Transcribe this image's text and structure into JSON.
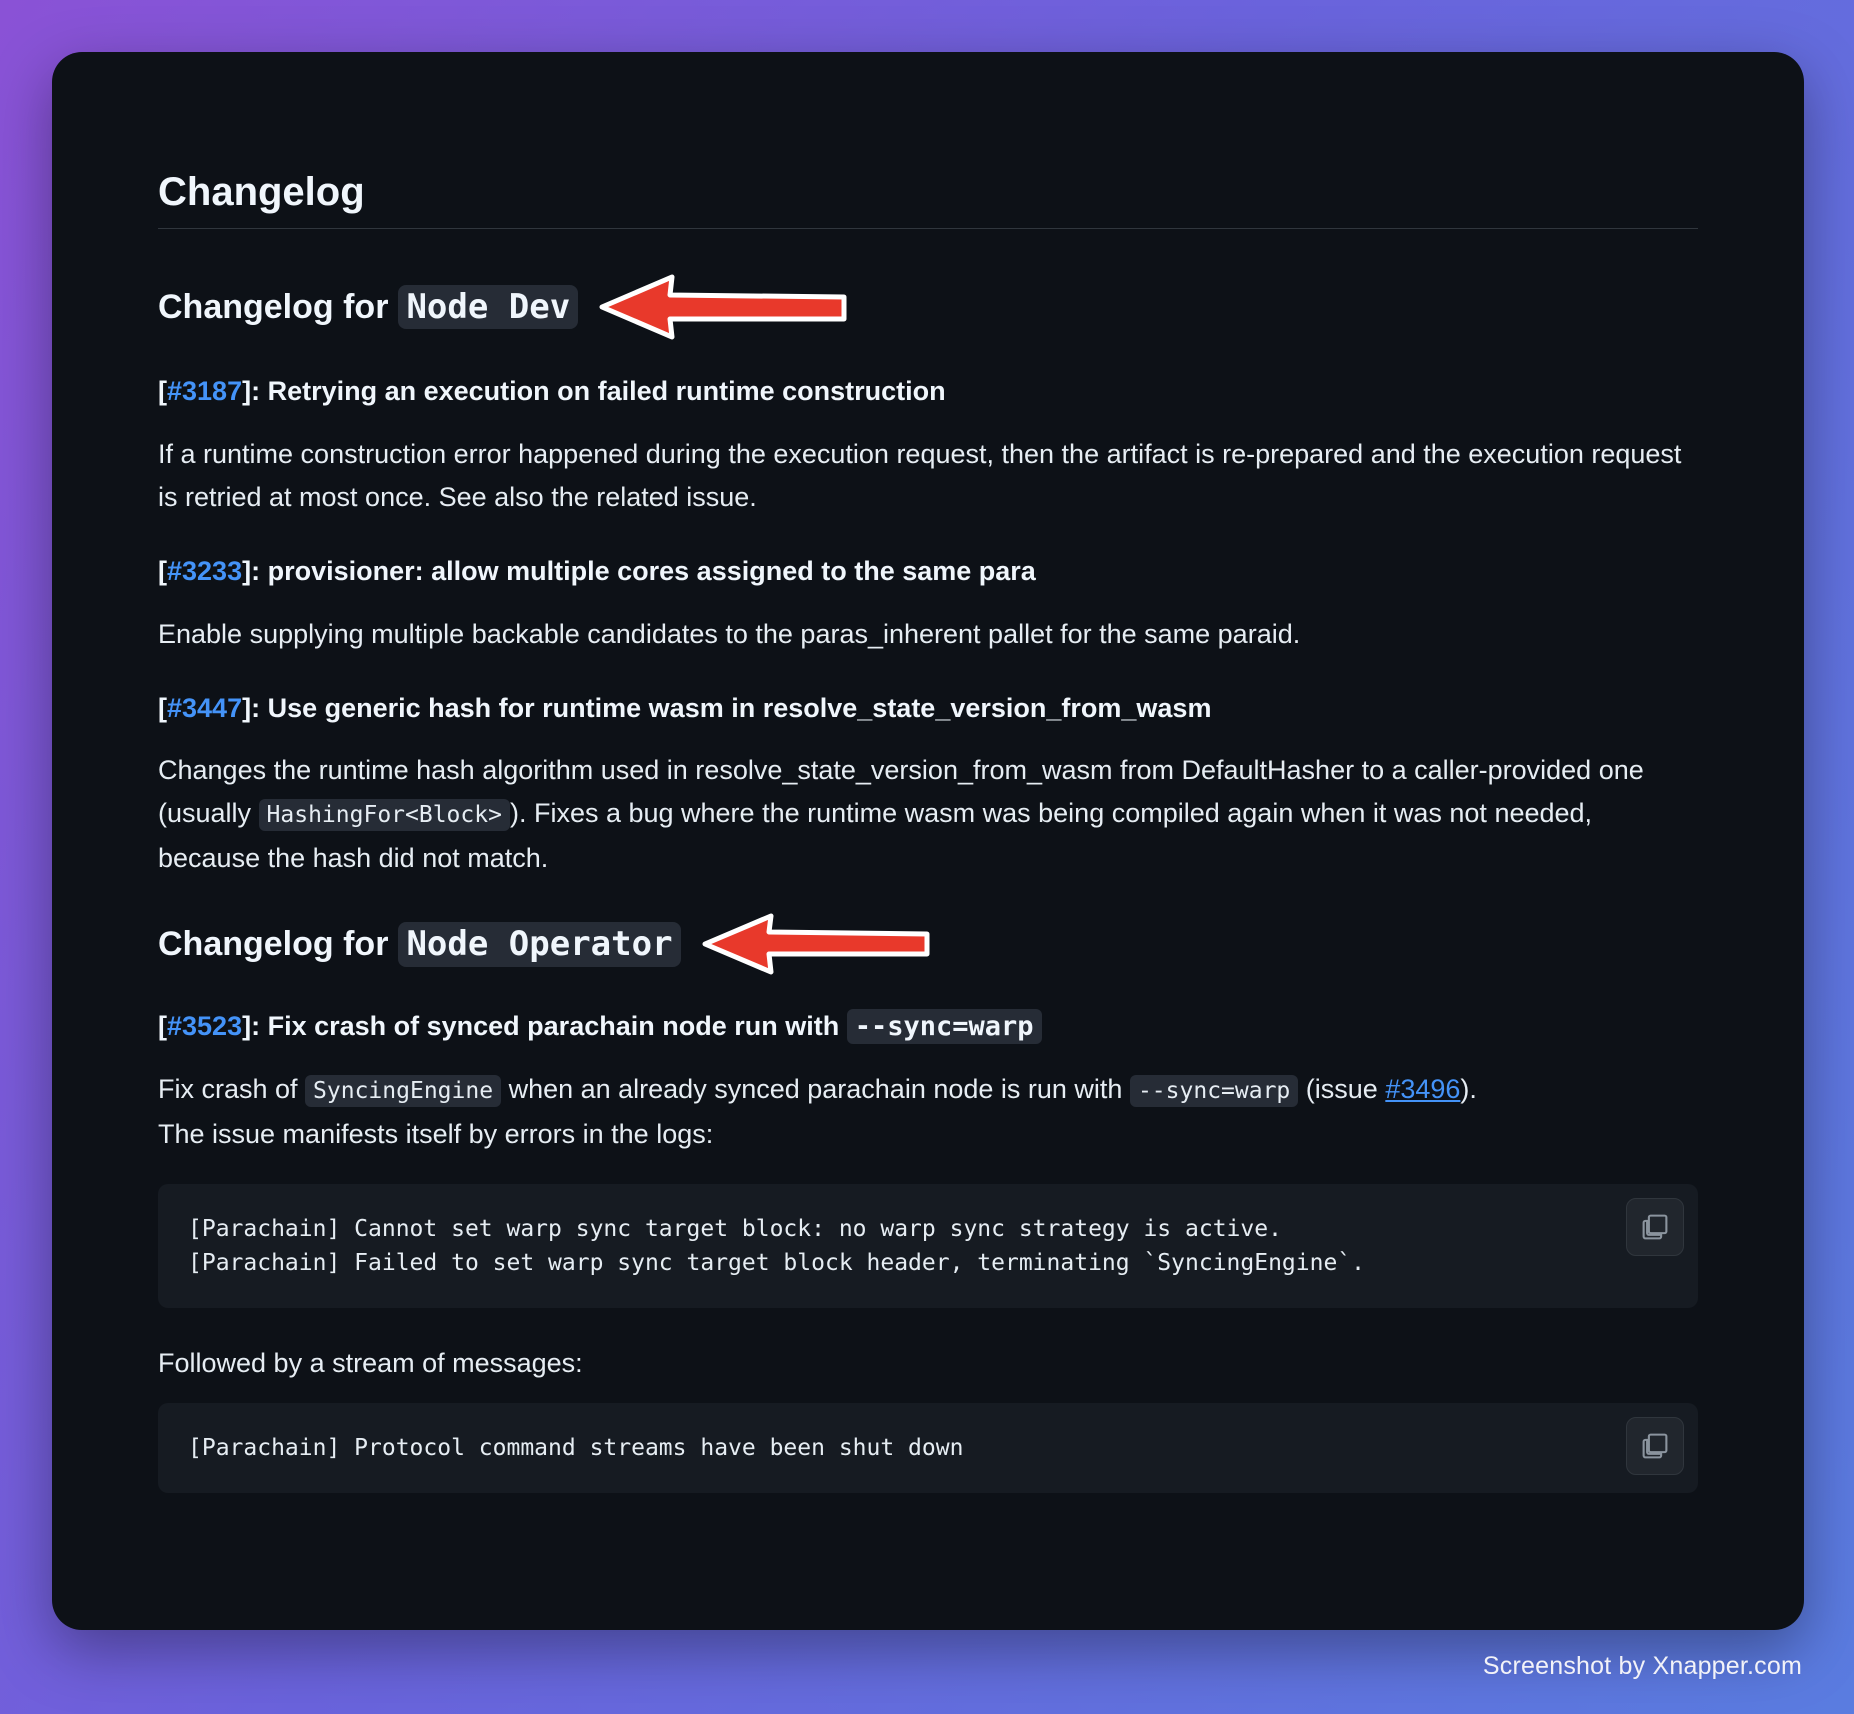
{
  "title": "Changelog",
  "sections": [
    {
      "heading_prefix": "Changelog for",
      "heading_code": "Node Dev",
      "entries": [
        {
          "pr": "#3187",
          "title": "Retrying an execution on failed runtime construction",
          "body": "If a runtime construction error happened during the execution request, then the artifact is re-prepared and the execution request is retried at most once. See also the related issue."
        },
        {
          "pr": "#3233",
          "title": "provisioner: allow multiple cores assigned to the same para",
          "body": "Enable supplying multiple backable candidates to the paras_inherent pallet for the same paraid."
        },
        {
          "pr": "#3447",
          "title": "Use generic hash for runtime wasm in resolve_state_version_from_wasm",
          "body_before": "Changes the runtime hash algorithm used in resolve_state_version_from_wasm from DefaultHasher to a caller-provided one (usually ",
          "body_code": "HashingFor<Block>",
          "body_after": "). Fixes a bug where the runtime wasm was being compiled again when it was not needed, because the hash did not match."
        }
      ]
    },
    {
      "heading_prefix": "Changelog for",
      "heading_code": "Node Operator",
      "entries": [
        {
          "pr": "#3523",
          "title": "Fix crash of synced parachain node run with",
          "title_code": "--sync=warp",
          "body_1": "Fix crash of ",
          "body_code_1": "SyncingEngine",
          "body_2": " when an already synced parachain node is run with ",
          "body_code_2": "--sync=warp",
          "body_3": " (issue ",
          "issue_link": "#3496",
          "body_4": ").",
          "body_line2": "The issue manifests itself by errors in the logs:",
          "code_block_1": "[Parachain] Cannot set warp sync target block: no warp sync strategy is active.\n[Parachain] Failed to set warp sync target block header, terminating `SyncingEngine`.",
          "followed_by": "Followed by a stream of messages:",
          "code_block_2": "[Parachain] Protocol command streams have been shut down"
        }
      ]
    }
  ],
  "icons": {
    "copy": "copy-icon",
    "arrow": "red-arrow-annotation"
  },
  "colors": {
    "link": "#4493f8",
    "arrow": "#e8392b",
    "background": "#0d1117"
  },
  "watermark": "Screenshot by Xnapper.com"
}
